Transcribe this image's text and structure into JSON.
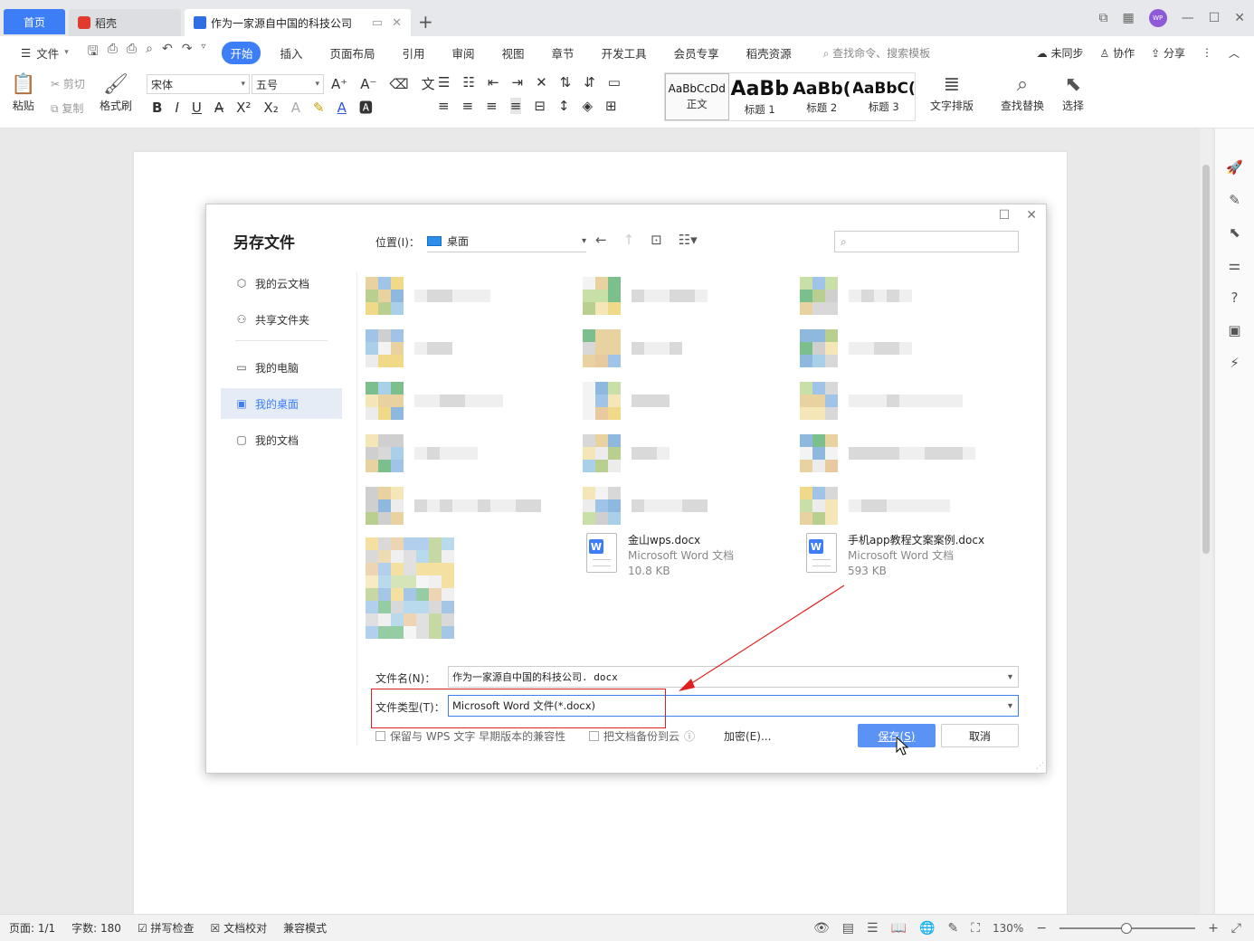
{
  "tabs": {
    "home": "首页",
    "daoke": "稻壳",
    "doc": "作为一家源自中国的科技公司"
  },
  "menu": {
    "file": "文件",
    "items": [
      "开始",
      "插入",
      "页面布局",
      "引用",
      "审阅",
      "视图",
      "章节",
      "开发工具",
      "会员专享",
      "稻壳资源"
    ],
    "active": "开始",
    "search": "查找命令、搜索模板",
    "right": [
      "未同步",
      "协作",
      "分享"
    ]
  },
  "ribbon": {
    "paste": "粘贴",
    "cut": "剪切",
    "copy": "复制",
    "format_painter": "格式刷",
    "font_name": "宋体",
    "font_size": "五号",
    "styles": [
      {
        "sample": "AaBbCcDd",
        "label": "正文"
      },
      {
        "sample": "AaBb",
        "label": "标题 1"
      },
      {
        "sample": "AaBb(",
        "label": "标题 2"
      },
      {
        "sample": "AaBbC(",
        "label": "标题 3"
      }
    ],
    "text_layout": "文字排版",
    "find_replace": "查找替换",
    "select": "选择"
  },
  "dialog": {
    "title": "另存文件",
    "nav": [
      {
        "label": "我的云文档",
        "icon": "cloud-icon"
      },
      {
        "label": "共享文件夹",
        "icon": "share-folder-icon"
      },
      {
        "label": "我的电脑",
        "icon": "computer-icon"
      },
      {
        "label": "我的桌面",
        "icon": "desktop-icon"
      },
      {
        "label": "我的文档",
        "icon": "documents-icon"
      }
    ],
    "active_nav": "我的桌面",
    "location_label": "位置(I)：",
    "location_value": "桌面",
    "files": [
      {
        "name": "金山wps.docx",
        "type": "Microsoft Word 文档",
        "size": "10.8 KB"
      },
      {
        "name": "手机app教程文案案例.docx",
        "type": "Microsoft Word 文档",
        "size": "593 KB"
      }
    ],
    "filename_label": "文件名(N)：",
    "filename_value": "作为一家源自中国的科技公司. docx",
    "filetype_label": "文件类型(T)：",
    "filetype_value": "Microsoft Word 文件(*.docx)",
    "compat_check": "保留与 WPS 文字 早期版本的兼容性",
    "backup_check": "把文档备份到云",
    "encrypt": "加密(E)...",
    "save": "保存(S)",
    "cancel": "取消"
  },
  "status": {
    "page": "页面: 1/1",
    "words": "字数: 180",
    "spell": "拼写检查",
    "proof": "文档校对",
    "compat": "兼容模式",
    "zoom": "130%"
  },
  "colors": {
    "accent": "#3d7ef7",
    "annotation": "#e02020"
  }
}
